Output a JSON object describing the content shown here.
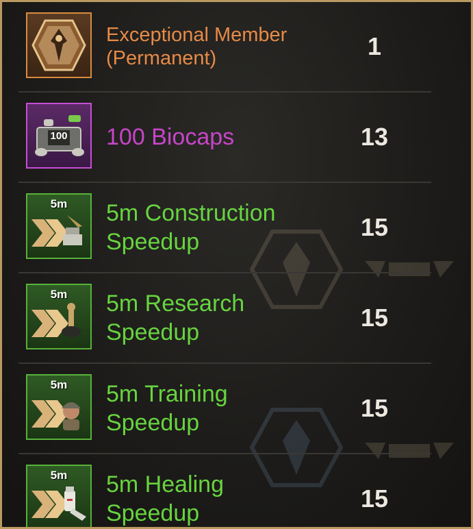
{
  "rewards": [
    {
      "name_line1": "Exceptional Member",
      "name_line2": "(Permanent)",
      "quantity": "1",
      "rarity_color": "#e88a46",
      "icon": "exceptional-member-badge-icon"
    },
    {
      "name_line1": "100 Biocaps",
      "name_line2": "",
      "quantity": "13",
      "rarity_color": "#c745c8",
      "icon": "biocaps-crate-icon",
      "icon_label": "100"
    },
    {
      "name_line1": "5m Construction",
      "name_line2": "Speedup",
      "quantity": "15",
      "rarity_color": "#67d43f",
      "icon": "construction-speedup-icon",
      "icon_label": "5m"
    },
    {
      "name_line1": "5m Research",
      "name_line2": "Speedup",
      "quantity": "15",
      "rarity_color": "#67d43f",
      "icon": "research-speedup-icon",
      "icon_label": "5m"
    },
    {
      "name_line1": "5m Training",
      "name_line2": "Speedup",
      "quantity": "15",
      "rarity_color": "#67d43f",
      "icon": "training-speedup-icon",
      "icon_label": "5m"
    },
    {
      "name_line1": "5m Healing",
      "name_line2": "Speedup",
      "quantity": "15",
      "rarity_color": "#67d43f",
      "icon": "healing-speedup-icon",
      "icon_label": "5m"
    }
  ],
  "colors": {
    "frame_border": "#b99a62",
    "quantity_text": "#ece8e0"
  }
}
